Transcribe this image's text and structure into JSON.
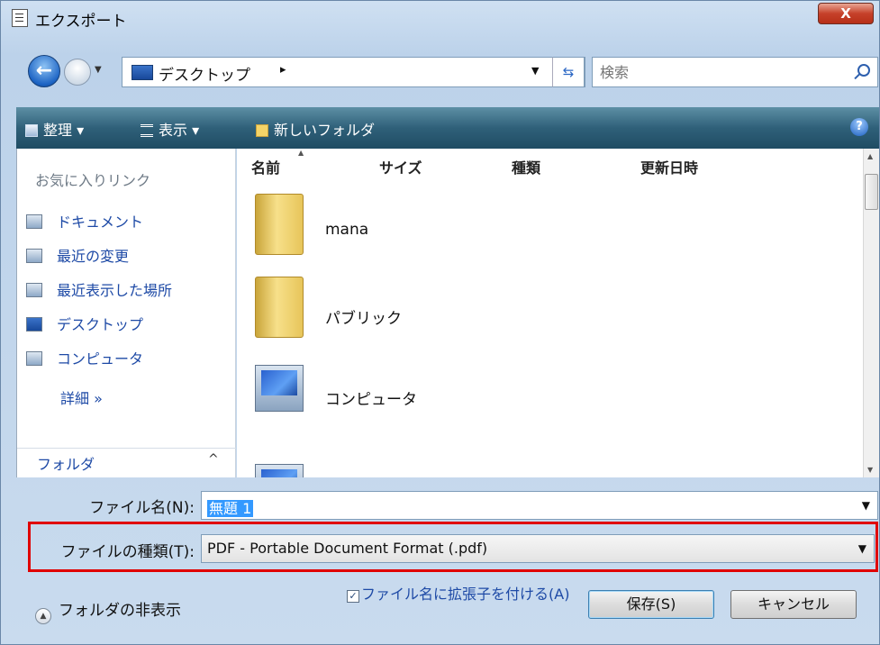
{
  "window": {
    "title": "エクスポート",
    "close_label": "X"
  },
  "nav": {
    "address": "デスクトップ",
    "address_arrow": "▸",
    "search_placeholder": "検索"
  },
  "toolbar": {
    "organize": "整理 ▾",
    "view": "表示 ▾",
    "new_folder": "新しいフォルダ",
    "help": "?"
  },
  "sidebar": {
    "header": "お気に入りリンク",
    "items": [
      {
        "label": "ドキュメント",
        "icon": "documents-icon"
      },
      {
        "label": "最近の変更",
        "icon": "recent-changes-icon"
      },
      {
        "label": "最近表示した場所",
        "icon": "recent-places-icon"
      },
      {
        "label": "デスクトップ",
        "icon": "desktop-icon"
      },
      {
        "label": "コンピュータ",
        "icon": "computer-icon"
      }
    ],
    "more": "詳細 »",
    "folders": "フォルダ",
    "folders_caret": "^"
  },
  "filelist": {
    "columns": [
      "名前",
      "サイズ",
      "種類",
      "更新日時"
    ],
    "files": [
      {
        "name": "mana",
        "icon": "user-folder-icon"
      },
      {
        "name": "パブリック",
        "icon": "folder-icon"
      },
      {
        "name": "コンピュータ",
        "icon": "computer-icon"
      }
    ]
  },
  "form": {
    "filename_label": "ファイル名(N):",
    "filename_value": "無題 1",
    "filetype_label": "ファイルの種類(T):",
    "filetype_value": "PDF - Portable Document Format (.pdf)",
    "hide_folders": "フォルダの非表示",
    "ext_checkbox_label": "ファイル名に拡張子を付ける(A)",
    "ext_checked": true,
    "save": "保存(S)",
    "cancel": "キャンセル"
  },
  "colors": {
    "highlight_border": "#e00000",
    "toolbar": "#2f6079",
    "link": "#1e4aa6"
  }
}
